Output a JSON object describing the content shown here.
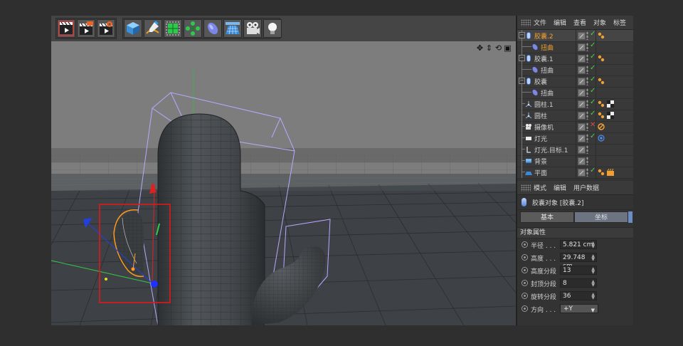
{
  "toolbar": {
    "groups": [
      {
        "buttons": [
          "render-view-icon",
          "render-picture-viewer-icon",
          "render-settings-icon"
        ]
      },
      {
        "buttons": [
          "cube-icon",
          "pen-spline-icon",
          "subdivision-icon",
          "array-icon",
          "deformer-bend-icon",
          "floor-plane-icon",
          "camera-icon",
          "light-bulb-icon"
        ]
      }
    ]
  },
  "viewport": {
    "nav_icons": [
      "✥",
      "⇕",
      "⟲",
      "▣"
    ]
  },
  "object_manager": {
    "menu": [
      "文件",
      "编辑",
      "查看",
      "对象",
      "标签"
    ],
    "rows": [
      {
        "name": "胶囊.2",
        "indent": 0,
        "icon": "capsule-icon",
        "active": true,
        "expander": true,
        "tags": [
          "deformer-tag-icon"
        ]
      },
      {
        "name": "扭曲",
        "indent": 1,
        "icon": "twist-deformer-icon",
        "active": true,
        "tags": []
      },
      {
        "name": "胶囊.1",
        "indent": 0,
        "icon": "capsule-icon",
        "expander": true,
        "tags": [
          "deformer-tag-icon"
        ]
      },
      {
        "name": "扭曲",
        "indent": 1,
        "icon": "twist-deformer-icon",
        "tags": []
      },
      {
        "name": "胶囊",
        "indent": 0,
        "icon": "capsule-icon",
        "expander": true,
        "tags": [
          "deformer-tag-icon"
        ]
      },
      {
        "name": "扭曲",
        "indent": 1,
        "icon": "twist-deformer-icon",
        "tags": []
      },
      {
        "name": "圆柱.1",
        "indent": 0,
        "icon": "cylinder-icon",
        "tags": [
          "deformer-tag-icon",
          "checker-tag-icon"
        ]
      },
      {
        "name": "圆柱",
        "indent": 0,
        "icon": "cylinder-icon",
        "tags": [
          "deformer-tag-icon",
          "checker-tag-icon"
        ]
      },
      {
        "name": "摄像机",
        "indent": 0,
        "icon": "camera-icon",
        "check": "x",
        "tags": [
          "protection-tag-icon"
        ]
      },
      {
        "name": "灯光",
        "indent": 0,
        "icon": "light-icon",
        "tags": [
          "target-tag-icon"
        ]
      },
      {
        "name": "灯光.目标.1",
        "indent": 0,
        "icon": "null-target-icon",
        "check": "none",
        "tags": []
      },
      {
        "name": "背景",
        "indent": 0,
        "icon": "background-icon",
        "check": "none",
        "tags": []
      },
      {
        "name": "平面",
        "indent": 0,
        "icon": "plane-icon",
        "tags": [
          "deformer-tag-icon",
          "material-tag-icon"
        ]
      }
    ]
  },
  "attribute_manager": {
    "menu": [
      "模式",
      "编辑",
      "用户数据"
    ],
    "object_title": "胶囊对象 [胶囊.2]",
    "tabs": [
      "基本",
      "坐标"
    ],
    "section": "对象属性",
    "params": [
      {
        "label": "半径 . . .",
        "value": "5.821 cm"
      },
      {
        "label": "高度 . . .",
        "value": "29.748 cm"
      },
      {
        "label": "高度分段",
        "value": "13"
      },
      {
        "label": "封顶分段",
        "value": "8"
      },
      {
        "label": "旋转分段",
        "value": "36"
      }
    ],
    "direction": {
      "label": "方向 . . .",
      "value": "+Y"
    }
  },
  "colors": {
    "selection_box": "#e01818",
    "active_object": "#f0a030",
    "check_green": "#47d147",
    "cage": "#b7a9ff"
  }
}
